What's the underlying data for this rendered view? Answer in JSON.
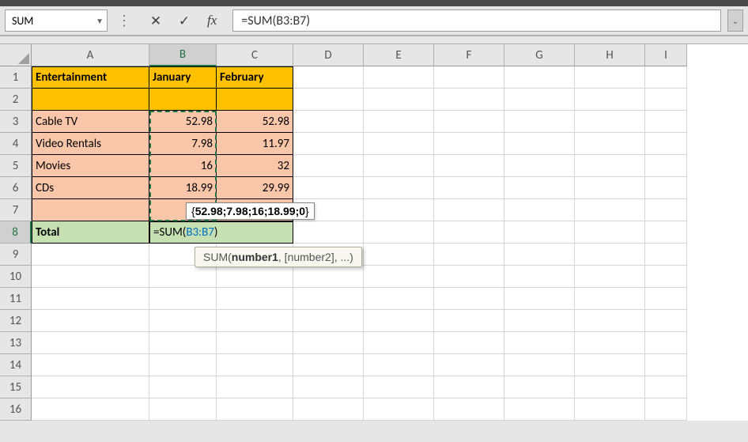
{
  "namebox": {
    "value": "SUM"
  },
  "formula_bar": {
    "value": "=SUM(B3:B7)",
    "cancel_glyph": "✕",
    "accept_glyph": "✓",
    "fx_label": "fx"
  },
  "columns": [
    "A",
    "B",
    "C",
    "D",
    "E",
    "F",
    "G",
    "H",
    "I"
  ],
  "rows": [
    "1",
    "2",
    "3",
    "4",
    "5",
    "6",
    "7",
    "8",
    "9",
    "10",
    "11",
    "12",
    "13",
    "14",
    "15",
    "16"
  ],
  "active_col": "B",
  "active_row": "8",
  "cells": {
    "A1": "Entertainment",
    "B1": "January",
    "C1": "February",
    "A3": "Cable TV",
    "B3": "52.98",
    "C3": "52.98",
    "A4": "Video Rentals",
    "B4": "7.98",
    "C4": "11.97",
    "A5": "Movies",
    "B5": "16",
    "C5": "32",
    "A6": "CDs",
    "B6": "18.99",
    "C6": "29.99",
    "A8": "Total",
    "B8_formula_prefix": "=SUM(",
    "B8_formula_ref": "B3:B7",
    "B8_formula_suffix": ")"
  },
  "array_preview": {
    "open": "{",
    "values": "52.98;7.98;16;18.99;0",
    "close": "}"
  },
  "tooltip": {
    "func": "SUM(",
    "arg_bold": "number1",
    "rest": ", [number2], ...)"
  }
}
